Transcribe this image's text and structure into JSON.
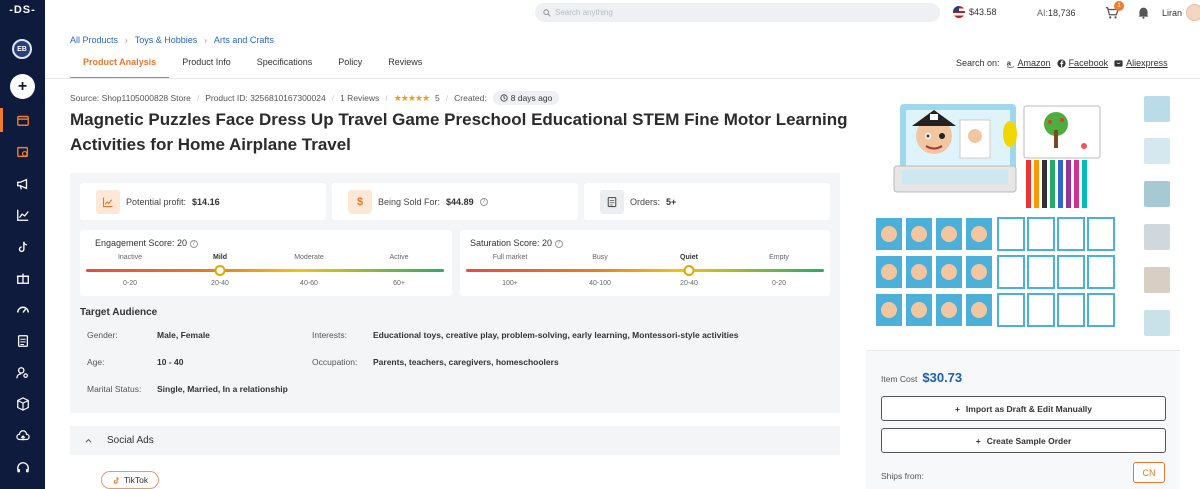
{
  "sidebar": {
    "logo": "-DS-",
    "account_badge": "EB",
    "items": [
      {
        "icon": "store-icon",
        "active": true
      },
      {
        "icon": "research-icon"
      },
      {
        "icon": "megaphone-icon"
      },
      {
        "icon": "chart-icon"
      },
      {
        "icon": "tiktok-icon"
      },
      {
        "icon": "gift-icon"
      },
      {
        "icon": "speedometer-icon"
      },
      {
        "icon": "document-icon"
      },
      {
        "icon": "user-search-icon"
      },
      {
        "icon": "box-icon"
      },
      {
        "icon": "cloud-upload-icon"
      },
      {
        "icon": "support-icon"
      }
    ]
  },
  "topbar": {
    "search_placeholder": "Search anything",
    "balance": "$43.58",
    "ai_label": "AI:",
    "ai_credits": "18,736",
    "cart_count": "1",
    "username": "Liran"
  },
  "breadcrumb": [
    "All Products",
    "Toys & Hobbies",
    "Arts and Crafts"
  ],
  "tabs": [
    {
      "label": "Product Analysis",
      "active": true
    },
    {
      "label": "Product Info"
    },
    {
      "label": "Specifications"
    },
    {
      "label": "Policy"
    },
    {
      "label": "Reviews"
    }
  ],
  "search_on": {
    "label": "Search on:",
    "sites": [
      "Amazon",
      "Facebook",
      "Aliexpress"
    ]
  },
  "meta": {
    "source": "Source: Shop1105000828 Store",
    "product_id": "Product ID: 3256810167300024",
    "reviews": "1 Reviews",
    "stars": "★★★★★",
    "rating": "5",
    "created_label": "Created:",
    "created_value": "8 days ago"
  },
  "title": "Magnetic Puzzles Face Dress Up Travel Game Preschool Educational STEM Fine Motor Learning Activities for Home Airplane Travel",
  "stats": {
    "profit_label": "Potential profit:",
    "profit_value": "$14.16",
    "sold_label": "Being Sold For:",
    "sold_value": "$44.89",
    "orders_label": "Orders:",
    "orders_value": "5+"
  },
  "engagement": {
    "label": "Engagement Score: 20",
    "levels": [
      "Inactive",
      "Mild",
      "Moderate",
      "Active"
    ],
    "ranges": [
      "0-20",
      "20-40",
      "40-60",
      "60+"
    ],
    "selected_index": 1
  },
  "saturation": {
    "label": "Saturation Score: 20",
    "levels": [
      "Full market",
      "Busy",
      "Quiet",
      "Empty"
    ],
    "ranges": [
      "100+",
      "40-100",
      "20-40",
      "0-20"
    ],
    "selected_index": 2
  },
  "target": {
    "title": "Target Audience",
    "gender_label": "Gender:",
    "gender_value": "Male, Female",
    "age_label": "Age:",
    "age_value": "10 - 40",
    "marital_label": "Marital Status:",
    "marital_value": "Single, Married, In a relationship",
    "interests_label": "Interests:",
    "interests_value": "Educational toys, creative play, problem-solving, early learning, Montessori-style activities",
    "occupation_label": "Occupation:",
    "occupation_value": "Parents, teachers, caregivers, homeschoolers"
  },
  "social": {
    "title": "Social Ads",
    "platform": "TikTok"
  },
  "buy": {
    "item_cost_label": "Item Cost",
    "item_cost_value": "$30.73",
    "import_button": "Import as Draft & Edit Manually",
    "sample_button": "Create Sample Order",
    "ships_from_label": "Ships from:",
    "ships_from_value": "CN"
  },
  "colors": {
    "sidebar": "#0f1b3d",
    "accent": "#e8772e",
    "link": "#2a66c5",
    "price": "#1a5fb4"
  }
}
